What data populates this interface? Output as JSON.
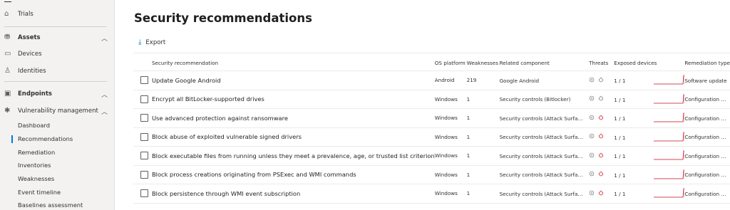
{
  "sidebar": {
    "trials": "Trials",
    "assets": "Assets",
    "devices": "Devices",
    "identities": "Identities",
    "endpoints": "Endpoints",
    "vuln_mgmt": "Vulnerability management",
    "sub": [
      "Dashboard",
      "Recommendations",
      "Remediation",
      "Inventories",
      "Weaknesses",
      "Event timeline",
      "Baselines assessment"
    ],
    "active_index": 1
  },
  "page": {
    "title": "Security recommendations",
    "export_label": "Export"
  },
  "table": {
    "headers": {
      "recommendation": "Security recommendation",
      "os": "OS platform",
      "weaknesses": "Weaknesses",
      "component": "Related component",
      "threats": "Threats",
      "exposed": "Exposed devices",
      "remediation": "Remediation type"
    },
    "rows": [
      {
        "recommendation": "Update Google Android",
        "os": "Android",
        "weaknesses": "219",
        "component": "Google Android",
        "exposed": "1 / 1",
        "remediation": "Software update",
        "threat_active": false
      },
      {
        "recommendation": "Encrypt all BitLocker-supported drives",
        "os": "Windows",
        "weaknesses": "1",
        "component": "Security controls (Bitlocker)",
        "exposed": "1 / 1",
        "remediation": "Configuration cha...",
        "threat_active": false
      },
      {
        "recommendation": "Use advanced protection against ransomware",
        "os": "Windows",
        "weaknesses": "1",
        "component": "Security controls (Attack Surface Redu...",
        "exposed": "1 / 1",
        "remediation": "Configuration cha...",
        "threat_active": true
      },
      {
        "recommendation": "Block abuse of exploited vulnerable signed drivers",
        "os": "Windows",
        "weaknesses": "1",
        "component": "Security controls (Attack Surface Redu...",
        "exposed": "1 / 1",
        "remediation": "Configuration cha...",
        "threat_active": true
      },
      {
        "recommendation": "Block executable files from running unless they meet a prevalence, age, or trusted list criterion",
        "os": "Windows",
        "weaknesses": "1",
        "component": "Security controls (Attack Surface Redu...",
        "exposed": "1 / 1",
        "remediation": "Configuration cha...",
        "threat_active": true
      },
      {
        "recommendation": "Block process creations originating from PSExec and WMI commands",
        "os": "Windows",
        "weaknesses": "1",
        "component": "Security controls (Attack Surface Redu...",
        "exposed": "1 / 1",
        "remediation": "Configuration cha...",
        "threat_active": true
      },
      {
        "recommendation": "Block persistence through WMI event subscription",
        "os": "Windows",
        "weaknesses": "1",
        "component": "Security controls (Attack Surface Redu...",
        "exposed": "1 / 1",
        "remediation": "Configuration cha...",
        "threat_active": true
      }
    ]
  },
  "colors": {
    "accent": "#0078d4",
    "threat_red": "#d13438",
    "sparkline": "#c50f1f",
    "spark_fill": "#f4c6c8"
  }
}
